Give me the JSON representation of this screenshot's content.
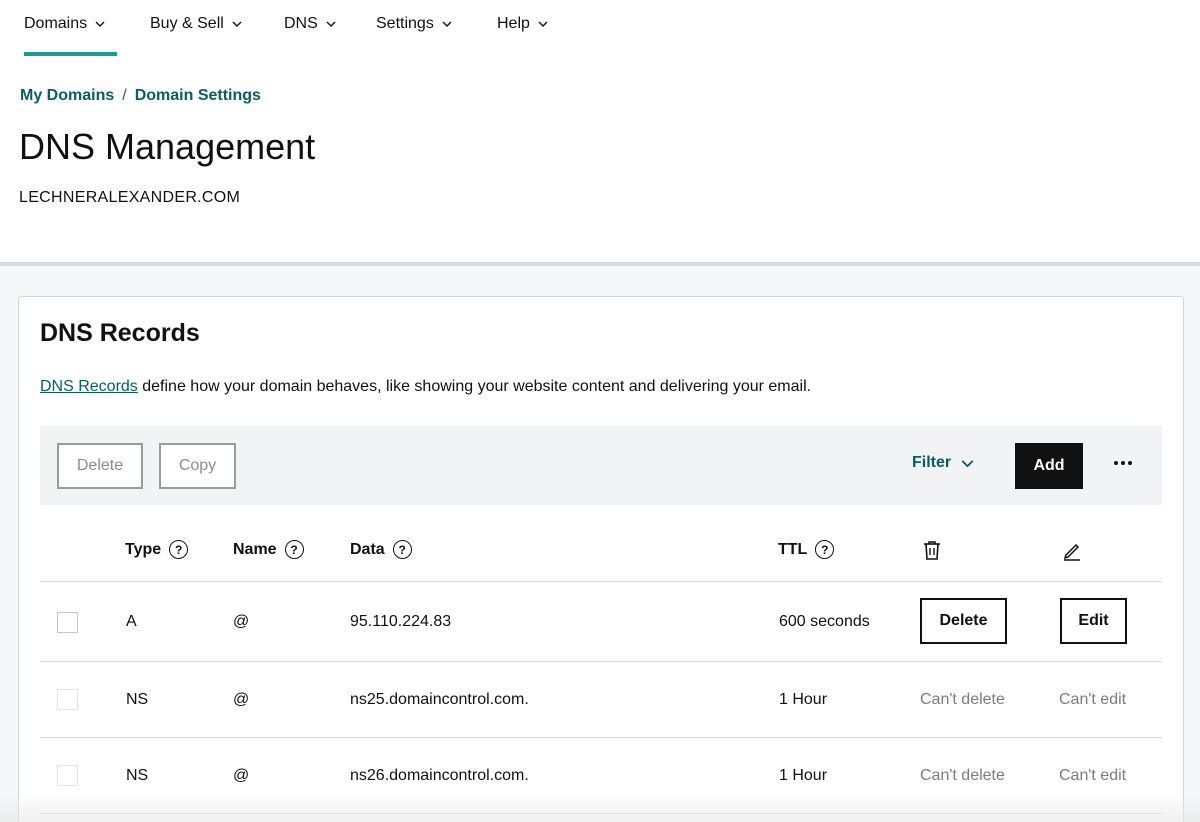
{
  "nav": {
    "items": [
      {
        "label": "Domains"
      },
      {
        "label": "Buy & Sell"
      },
      {
        "label": "DNS"
      },
      {
        "label": "Settings"
      },
      {
        "label": "Help"
      }
    ],
    "active": "Domains"
  },
  "breadcrumb": {
    "items": [
      "My Domains",
      "Domain Settings"
    ],
    "separator": "/"
  },
  "page": {
    "title": "DNS Management",
    "domain": "LECHNERALEXANDER.COM"
  },
  "records": {
    "title": "DNS Records",
    "description_link": "DNS Records",
    "description_rest": " define how your domain behaves, like showing your website content and delivering your email.",
    "toolbar": {
      "delete_label": "Delete",
      "copy_label": "Copy",
      "filter_label": "Filter",
      "add_label": "Add",
      "more_icon": "more-horizontal-icon"
    },
    "columns": {
      "type": "Type",
      "name": "Name",
      "data": "Data",
      "ttl": "TTL",
      "help_glyph": "?",
      "delete_icon": "trash-icon",
      "edit_icon": "pencil-icon"
    },
    "rows": [
      {
        "type": "A",
        "name": "@",
        "data": "95.110.224.83",
        "ttl": "600 seconds",
        "delete": "Delete",
        "edit": "Edit",
        "editable": true
      },
      {
        "type": "NS",
        "name": "@",
        "data": "ns25.domaincontrol.com.",
        "ttl": "1 Hour",
        "delete": "Can't delete",
        "edit": "Can't edit",
        "editable": false
      },
      {
        "type": "NS",
        "name": "@",
        "data": "ns26.domaincontrol.com.",
        "ttl": "1 Hour",
        "delete": "Can't delete",
        "edit": "Can't edit",
        "editable": false
      }
    ]
  },
  "colors": {
    "accent": "#1a9c96",
    "link": "#0a5c63",
    "primary_button": "#111111"
  }
}
